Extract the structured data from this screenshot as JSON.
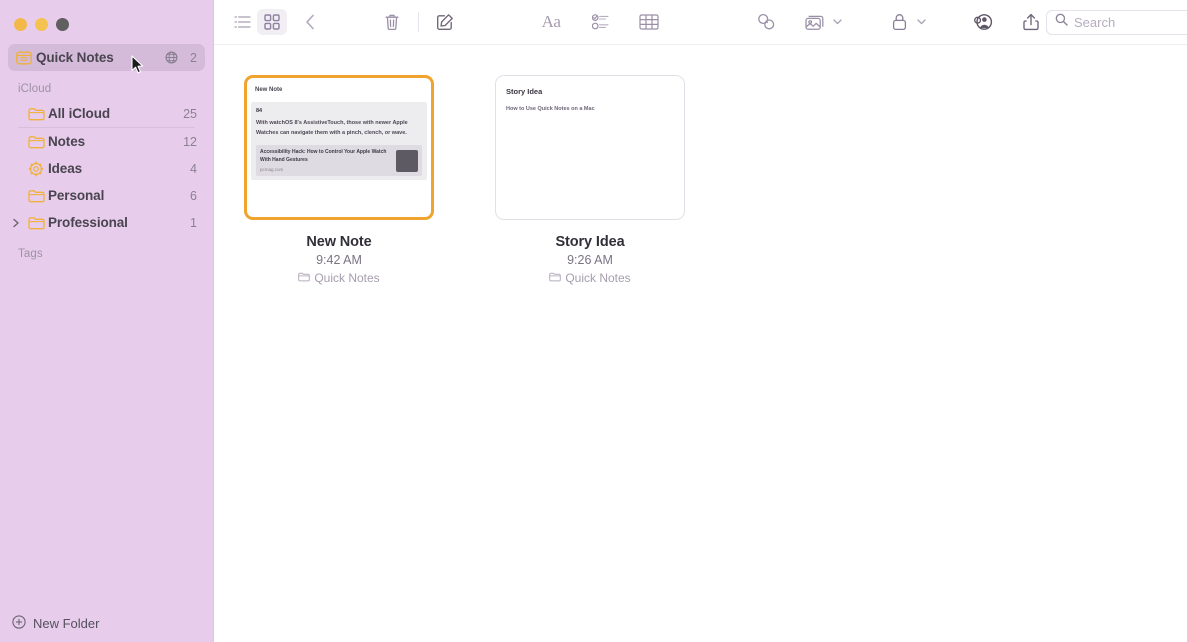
{
  "window": {
    "traffic_lights": [
      "close",
      "minimize",
      "zoom"
    ]
  },
  "sidebar": {
    "quick_notes": {
      "label": "Quick Notes",
      "icon": "quick-notes-icon",
      "shared_icon": "shared-globe-icon",
      "count": "2"
    },
    "sections": [
      {
        "title": "iCloud",
        "items": [
          {
            "label": "All iCloud",
            "icon": "folder-icon",
            "count": "25",
            "expandable": false
          },
          {
            "label": "Notes",
            "icon": "folder-icon",
            "count": "12",
            "expandable": false
          },
          {
            "label": "Ideas",
            "icon": "smart-folder-icon",
            "count": "4",
            "expandable": false
          },
          {
            "label": "Personal",
            "icon": "folder-icon",
            "count": "6",
            "expandable": false
          },
          {
            "label": "Professional",
            "icon": "folder-icon",
            "count": "1",
            "expandable": true
          }
        ]
      },
      {
        "title": "Tags",
        "items": []
      }
    ],
    "new_folder_label": "New Folder",
    "new_folder_icon": "plus-circle-icon"
  },
  "toolbar": {
    "list_view": "list-view-icon",
    "gallery_view": "gallery-view-icon",
    "back": "back-chevron-icon",
    "delete": "trash-icon",
    "compose": "compose-note-icon",
    "format": "format-aa-icon",
    "checklist": "checklist-icon",
    "table": "table-icon",
    "link": "link-icon",
    "media": "media-icon",
    "media_chevron": "chevron-down-icon",
    "lock": "lock-icon",
    "lock_chevron": "chevron-down-icon",
    "collaborate": "add-people-icon",
    "share": "share-icon"
  },
  "search": {
    "placeholder": "Search",
    "value": "",
    "icon": "search-icon"
  },
  "notes": [
    {
      "title": "New Note",
      "time": "9:42 AM",
      "folder": "Quick Notes",
      "folder_icon": "folder-small-icon",
      "selected": true,
      "preview": {
        "kind": "watch-note",
        "heading": "New Note",
        "subheading": "84",
        "body": "With watchOS 8's AssistiveTouch, those with newer Apple Watches can navigate them with a pinch, clench, or wave.",
        "link_title": "Accessibility Hack: How to Control Your Apple Watch With Hand Gestures",
        "link_domain": "pcmag.com"
      }
    },
    {
      "title": "Story Idea",
      "time": "9:26 AM",
      "folder": "Quick Notes",
      "folder_icon": "folder-small-icon",
      "selected": false,
      "preview": {
        "kind": "text-note",
        "heading": "Story Idea",
        "body": "How to Use Quick Notes on a Mac"
      }
    }
  ],
  "colors": {
    "sidebar_bg": "#e7cdeb",
    "selection_highlight": "#f0a32d",
    "folder_icon": "#f0b13c",
    "text_primary": "#332f38",
    "text_secondary": "#7b7384"
  }
}
